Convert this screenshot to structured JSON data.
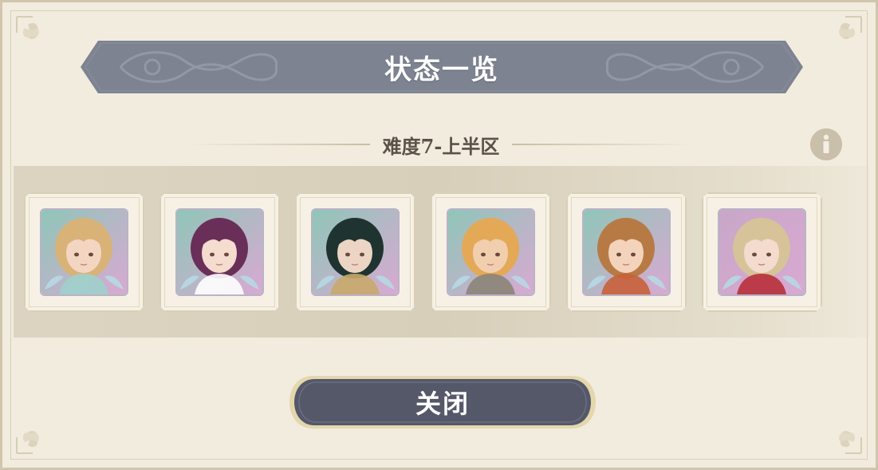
{
  "dialog": {
    "title": "状态一览",
    "subtitle": "难度7-上半区",
    "info_icon": "info-icon",
    "close_label": "关闭"
  },
  "characters": [
    {
      "name": "portrait-1",
      "hair": "#d9b277",
      "bg": "#8fc6b8",
      "skin": "#f3d6c2",
      "accent": "#9fd0cb"
    },
    {
      "name": "portrait-2",
      "hair": "#6a2f58",
      "bg": "#8fc6b8",
      "skin": "#f4dccf",
      "accent": "#ffffff"
    },
    {
      "name": "portrait-3",
      "hair": "#1f3430",
      "bg": "#8fc6b8",
      "skin": "#ecd5c4",
      "accent": "#c9a86b"
    },
    {
      "name": "portrait-4",
      "hair": "#e3a957",
      "bg": "#8fc6b8",
      "skin": "#f1cfae",
      "accent": "#8b8478"
    },
    {
      "name": "portrait-5",
      "hair": "#b87a45",
      "bg": "#8fc6b8",
      "skin": "#f3d3bb",
      "accent": "#c8603a"
    },
    {
      "name": "portrait-6",
      "hair": "#d6c39a",
      "bg": "#c8a7c8",
      "skin": "#f3dccd",
      "accent": "#b8303a"
    }
  ],
  "colors": {
    "banner": "#7d8390",
    "button": "#545869",
    "panel": "#f1ecde"
  }
}
